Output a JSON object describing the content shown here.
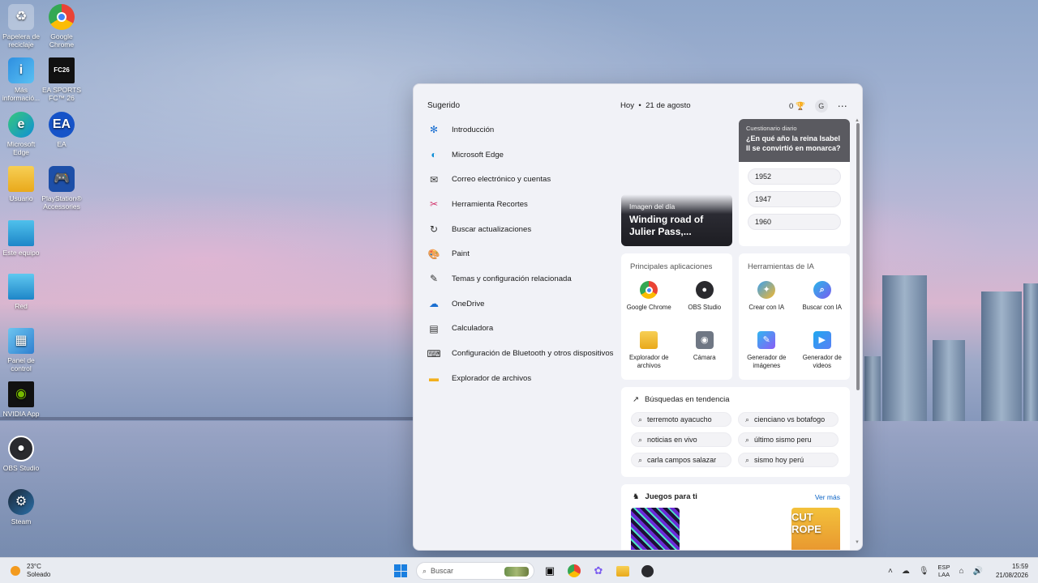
{
  "desktop": {
    "icons": [
      {
        "label": "Papelera de reciclaje",
        "icon": "recycle-bin-icon"
      },
      {
        "label": "Google Chrome",
        "icon": "chrome-icon"
      },
      {
        "label": "Más informació...",
        "icon": "info-icon"
      },
      {
        "label": "EA SPORTS FC™ 26",
        "icon": "fc26-icon"
      },
      {
        "label": "Microsoft Edge",
        "icon": "edge-icon"
      },
      {
        "label": "EA",
        "icon": "ea-icon"
      },
      {
        "label": "Usuario",
        "icon": "folder-icon"
      },
      {
        "label": "PlayStation® Accessories",
        "icon": "playstation-icon"
      },
      {
        "label": "Este equipo",
        "icon": "computer-icon"
      },
      {
        "label": "Red",
        "icon": "network-icon"
      },
      {
        "label": "Panel de control",
        "icon": "control-panel-icon"
      },
      {
        "label": "NVIDIA App",
        "icon": "nvidia-icon"
      },
      {
        "label": "OBS Studio",
        "icon": "obs-icon"
      },
      {
        "label": "Steam",
        "icon": "steam-icon"
      }
    ]
  },
  "start": {
    "suggested_title": "Sugerido",
    "suggested": [
      {
        "label": "Introducción",
        "icon": "intro-icon",
        "color": "#1a6fd1"
      },
      {
        "label": "Microsoft Edge",
        "icon": "edge-icon",
        "color": "#0f8fd6"
      },
      {
        "label": "Correo electrónico y cuentas",
        "icon": "mail-icon",
        "color": "#333333"
      },
      {
        "label": "Herramienta Recortes",
        "icon": "snipping-icon",
        "color": "#d2356d"
      },
      {
        "label": "Buscar actualizaciones",
        "icon": "update-icon",
        "color": "#333333"
      },
      {
        "label": "Paint",
        "icon": "paint-icon",
        "color": "#2a8fd9"
      },
      {
        "label": "Temas y configuración relacionada",
        "icon": "brush-icon",
        "color": "#333333"
      },
      {
        "label": "OneDrive",
        "icon": "onedrive-icon",
        "color": "#1a6fd1"
      },
      {
        "label": "Calculadora",
        "icon": "calculator-icon",
        "color": "#333333"
      },
      {
        "label": "Configuración de Bluetooth y otros dispositivos",
        "icon": "devices-icon",
        "color": "#333333"
      },
      {
        "label": "Explorador de archivos",
        "icon": "folder-icon",
        "color": "#f2b01e"
      }
    ],
    "today_label": "Hoy",
    "date": "21 de agosto",
    "rewards_points": "0",
    "avatar_letter": "G",
    "photo": {
      "label": "Imagen del día",
      "title": "Winding road of Julier Pass,..."
    },
    "quiz": {
      "label": "Cuestionario diario",
      "question": "¿En qué año la reina Isabel II se convirtió en monarca?",
      "options": [
        "1952",
        "1947",
        "1960"
      ]
    },
    "top_apps": {
      "title": "Principales aplicaciones",
      "items": [
        {
          "label": "Google Chrome",
          "icon": "chrome-icon"
        },
        {
          "label": "OBS Studio",
          "icon": "obs-icon"
        },
        {
          "label": "Explorador de archivos",
          "icon": "folder-icon"
        },
        {
          "label": "Cámara",
          "icon": "camera-icon"
        }
      ]
    },
    "ai_tools": {
      "title": "Herramientas de IA",
      "items": [
        {
          "label": "Crear con IA",
          "icon": "create-ai-icon"
        },
        {
          "label": "Buscar con IA",
          "icon": "search-ai-icon"
        },
        {
          "label": "Generador de imágenes",
          "icon": "image-gen-icon"
        },
        {
          "label": "Generador de videos",
          "icon": "video-gen-icon"
        }
      ]
    },
    "trending": {
      "title": "Búsquedas en tendencia",
      "items": [
        "terremoto ayacucho",
        "cienciano vs botafogo",
        "noticias en vivo",
        "último sismo peru",
        "carla campos salazar",
        "sismo hoy perú"
      ]
    },
    "games": {
      "title": "Juegos para ti",
      "more": "Ver más",
      "thumb2_text": "CUT ROPE"
    }
  },
  "taskbar": {
    "temperature": "23°C",
    "condition": "Soleado",
    "search_placeholder": "Buscar",
    "lang_top": "ESP",
    "lang_bottom": "LAA",
    "time": "15:59",
    "date": "21/08/2026"
  }
}
